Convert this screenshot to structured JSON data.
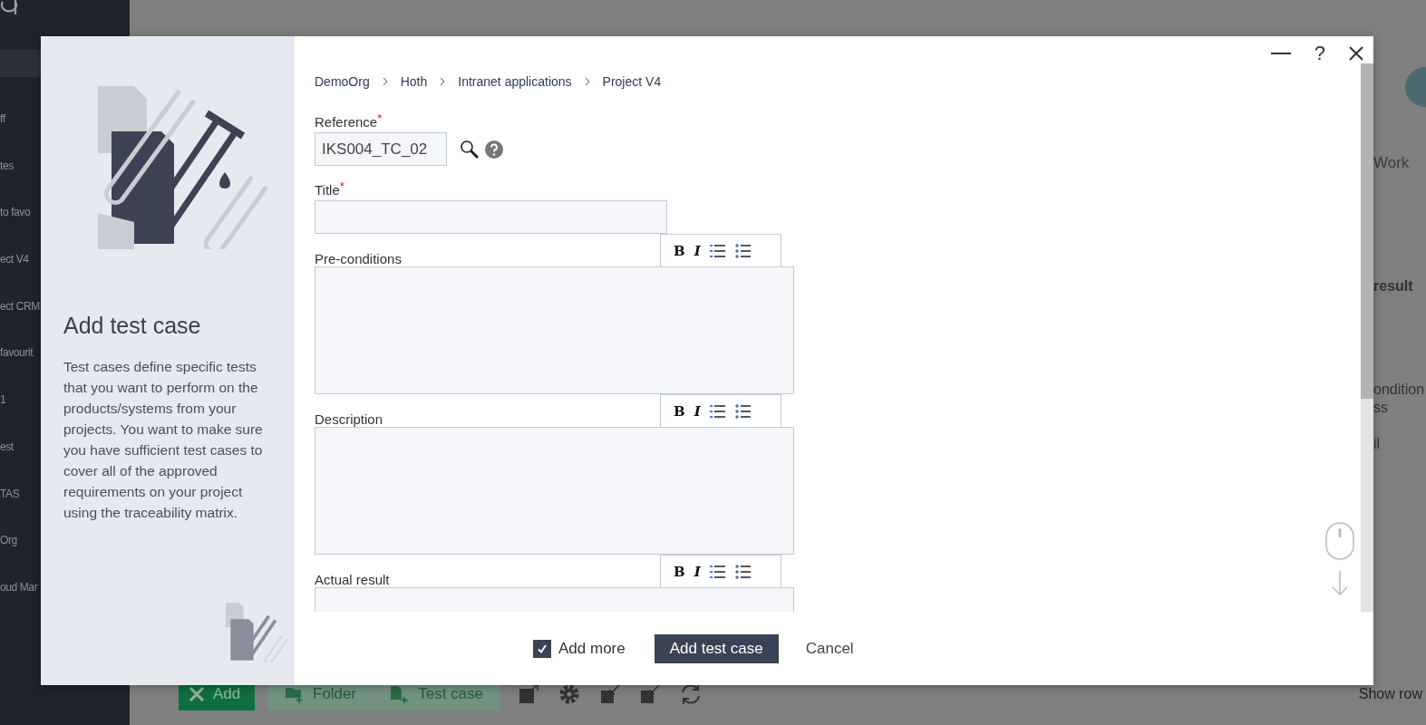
{
  "background": {
    "sidebar_items": [
      "ff",
      "tes",
      "to favo",
      "ect V4",
      "ect CRM",
      "favourit",
      "1",
      "est",
      "TAS",
      "Org",
      "oud Mar"
    ],
    "right_texts": [
      {
        "text": "Work",
        "kind": "tab"
      },
      {
        "text": "result",
        "kind": "header"
      },
      {
        "text": "ondition",
        "kind": "cell"
      },
      {
        "text": "ss",
        "kind": "cell"
      },
      {
        "text": "il",
        "kind": "cell"
      }
    ],
    "toolbar": {
      "buttons": [
        {
          "label": "Add",
          "kind": "primary"
        },
        {
          "label": "Folder",
          "kind": "folder"
        },
        {
          "label": "Test case",
          "kind": "testcase"
        }
      ],
      "show_rows": "Show row"
    }
  },
  "dialog": {
    "help": "?",
    "title": "Add test case",
    "description": "Test cases define specific tests that you want to perform on the products/systems from your projects. You want to make sure you have sufficient test cases to cover all of the approved requirements on your project using the traceability matrix.",
    "breadcrumb": [
      "DemoOrg",
      "Hoth",
      "Intranet applications",
      "Project V4"
    ],
    "fields": [
      {
        "kind": "lookup",
        "label": "Reference",
        "required": "*",
        "value": "IKS004_TC_02"
      },
      {
        "kind": "text",
        "label": "Title",
        "required": "*"
      },
      {
        "kind": "rich",
        "label": "Pre-conditions",
        "format": [
          "B",
          "I"
        ]
      },
      {
        "kind": "rich",
        "label": "Description",
        "format": [
          "B",
          "I"
        ]
      },
      {
        "kind": "rich",
        "label": "Actual result",
        "format": [
          "B",
          "I"
        ]
      }
    ],
    "add_more": {
      "label": "Add more",
      "checked": true
    },
    "buttons": [
      {
        "label": "Add test case",
        "kind": "primary"
      },
      {
        "label": "Cancel",
        "kind": "link"
      }
    ]
  }
}
